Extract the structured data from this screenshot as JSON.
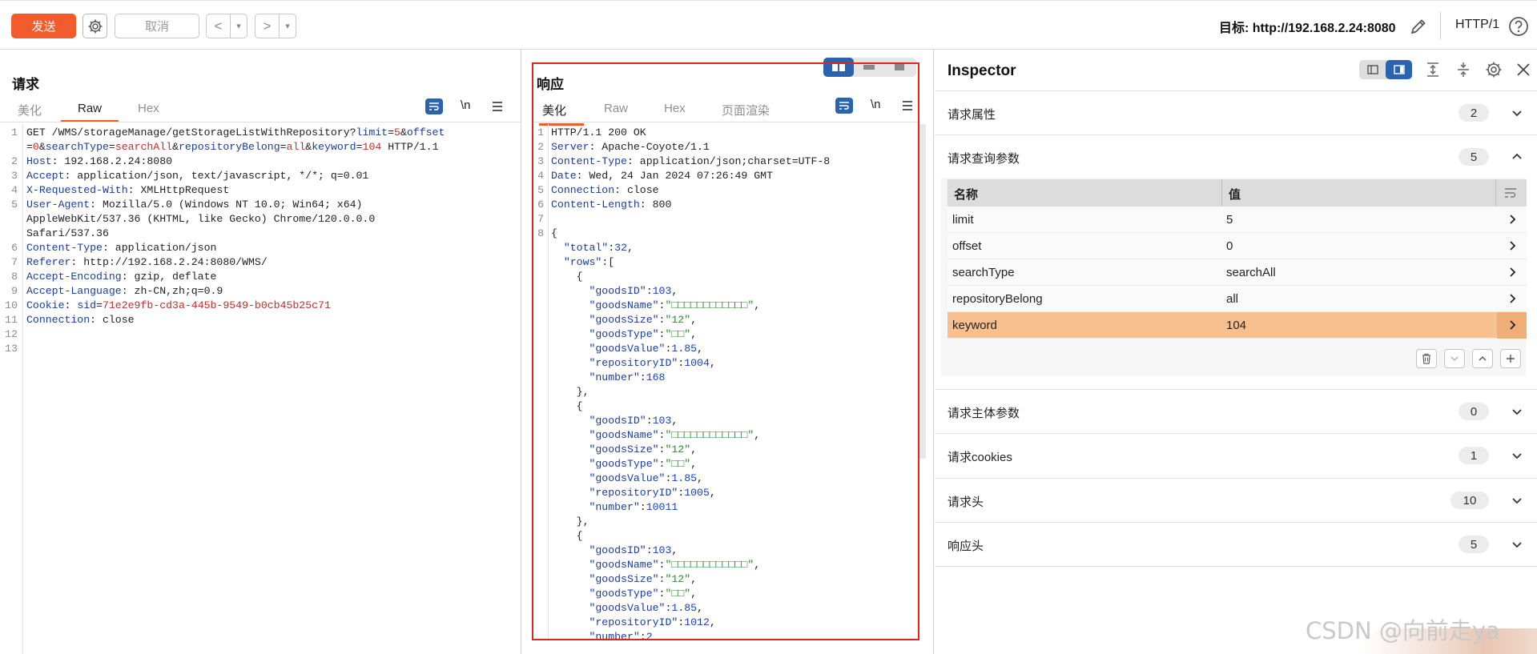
{
  "toolbar": {
    "send_label": "发送",
    "cancel_label": "取消",
    "back_icon": "<",
    "forward_icon": ">",
    "dropdown_icon": "▾",
    "target_label": "目标: http://192.168.2.24:8080",
    "http_version": "HTTP/1"
  },
  "request": {
    "title": "请求",
    "tabs": [
      "美化",
      "Raw",
      "Hex"
    ],
    "active_tab": "Raw",
    "newline_label": "\\n",
    "line_numbers": [
      "1",
      "",
      "2",
      "3",
      "4",
      "5",
      "",
      "",
      "6",
      "7",
      "8",
      "9",
      "10",
      "11",
      "12",
      "13"
    ],
    "lines": [
      [
        [
          "plain",
          "GET /WMS/storageManage/getStorageListWithRepository?"
        ],
        [
          "p",
          "limit"
        ],
        [
          "plain",
          "="
        ],
        [
          "v",
          "5"
        ],
        [
          "plain",
          "&"
        ],
        [
          "p",
          "offset"
        ]
      ],
      [
        [
          "plain",
          "="
        ],
        [
          "v",
          "0"
        ],
        [
          "plain",
          "&"
        ],
        [
          "p",
          "searchType"
        ],
        [
          "plain",
          "="
        ],
        [
          "v",
          "searchAll"
        ],
        [
          "plain",
          "&"
        ],
        [
          "p",
          "repositoryBelong"
        ],
        [
          "plain",
          "="
        ],
        [
          "v",
          "all"
        ],
        [
          "plain",
          "&"
        ],
        [
          "p",
          "keyword"
        ],
        [
          "plain",
          "="
        ],
        [
          "v",
          "104"
        ],
        [
          "plain",
          " HTTP/1.1"
        ]
      ],
      [
        [
          "k",
          "Host"
        ],
        [
          "plain",
          ": 192.168.2.24:8080"
        ]
      ],
      [
        [
          "k",
          "Accept"
        ],
        [
          "plain",
          ": application/json, text/javascript, */*; q=0.01"
        ]
      ],
      [
        [
          "k",
          "X-Requested-With"
        ],
        [
          "plain",
          ": XMLHttpRequest"
        ]
      ],
      [
        [
          "k",
          "User-Agent"
        ],
        [
          "plain",
          ": Mozilla/5.0 (Windows NT 10.0; Win64; x64)"
        ]
      ],
      [
        [
          "plain",
          "AppleWebKit/537.36 (KHTML, like Gecko) Chrome/120.0.0.0"
        ]
      ],
      [
        [
          "plain",
          "Safari/537.36"
        ]
      ],
      [
        [
          "k",
          "Content-Type"
        ],
        [
          "plain",
          ": application/json"
        ]
      ],
      [
        [
          "k",
          "Referer"
        ],
        [
          "plain",
          ": http://192.168.2.24:8080/WMS/"
        ]
      ],
      [
        [
          "k",
          "Accept-Encoding"
        ],
        [
          "plain",
          ": gzip, deflate"
        ]
      ],
      [
        [
          "k",
          "Accept-Language"
        ],
        [
          "plain",
          ": zh-CN,zh;q=0.9"
        ]
      ],
      [
        [
          "k",
          "Cookie"
        ],
        [
          "plain",
          ": "
        ],
        [
          "p",
          "sid"
        ],
        [
          "plain",
          "="
        ],
        [
          "v",
          "71e2e9fb-cd3a-445b-9549-b0cb45b25c71"
        ]
      ],
      [
        [
          "k",
          "Connection"
        ],
        [
          "plain",
          ": close"
        ]
      ],
      [
        [
          "plain",
          ""
        ]
      ],
      [
        [
          "plain",
          ""
        ]
      ]
    ]
  },
  "response": {
    "title": "响应",
    "tabs": [
      "美化",
      "Raw",
      "Hex",
      "页面渲染"
    ],
    "active_tab": "美化",
    "newline_label": "\\n",
    "line_numbers": [
      "1",
      "2",
      "3",
      "4",
      "5",
      "6",
      "7",
      "8"
    ],
    "lines": [
      [
        [
          "plain",
          "HTTP/1.1 200 OK"
        ]
      ],
      [
        [
          "k",
          "Server"
        ],
        [
          "plain",
          ": Apache-Coyote/1.1"
        ]
      ],
      [
        [
          "k",
          "Content-Type"
        ],
        [
          "plain",
          ": application/json;charset=UTF-8"
        ]
      ],
      [
        [
          "k",
          "Date"
        ],
        [
          "plain",
          ": Wed, 24 Jan 2024 07:26:49 GMT"
        ]
      ],
      [
        [
          "k",
          "Connection"
        ],
        [
          "plain",
          ": close"
        ]
      ],
      [
        [
          "k",
          "Content-Length"
        ],
        [
          "plain",
          ": 800"
        ]
      ],
      [
        [
          "plain",
          ""
        ]
      ],
      [
        [
          "plain",
          "{"
        ]
      ],
      [
        [
          "plain",
          "  "
        ],
        [
          "jk",
          "\"total\""
        ],
        [
          "plain",
          ":"
        ],
        [
          "n",
          "32"
        ],
        [
          "plain",
          ","
        ]
      ],
      [
        [
          "plain",
          "  "
        ],
        [
          "jk",
          "\"rows\""
        ],
        [
          "plain",
          ":["
        ]
      ],
      [
        [
          "plain",
          "    {"
        ]
      ],
      [
        [
          "plain",
          "      "
        ],
        [
          "jk",
          "\"goodsID\""
        ],
        [
          "plain",
          ":"
        ],
        [
          "n",
          "103"
        ],
        [
          "plain",
          ","
        ]
      ],
      [
        [
          "plain",
          "      "
        ],
        [
          "jk",
          "\"goodsName\""
        ],
        [
          "plain",
          ":"
        ],
        [
          "s",
          "\"□□□□□□□□□□□□\""
        ],
        [
          "plain",
          ","
        ]
      ],
      [
        [
          "plain",
          "      "
        ],
        [
          "jk",
          "\"goodsSize\""
        ],
        [
          "plain",
          ":"
        ],
        [
          "s",
          "\"12\""
        ],
        [
          "plain",
          ","
        ]
      ],
      [
        [
          "plain",
          "      "
        ],
        [
          "jk",
          "\"goodsType\""
        ],
        [
          "plain",
          ":"
        ],
        [
          "s",
          "\"□□\""
        ],
        [
          "plain",
          ","
        ]
      ],
      [
        [
          "plain",
          "      "
        ],
        [
          "jk",
          "\"goodsValue\""
        ],
        [
          "plain",
          ":"
        ],
        [
          "n",
          "1.85"
        ],
        [
          "plain",
          ","
        ]
      ],
      [
        [
          "plain",
          "      "
        ],
        [
          "jk",
          "\"repositoryID\""
        ],
        [
          "plain",
          ":"
        ],
        [
          "n",
          "1004"
        ],
        [
          "plain",
          ","
        ]
      ],
      [
        [
          "plain",
          "      "
        ],
        [
          "jk",
          "\"number\""
        ],
        [
          "plain",
          ":"
        ],
        [
          "n",
          "168"
        ]
      ],
      [
        [
          "plain",
          "    },"
        ]
      ],
      [
        [
          "plain",
          "    {"
        ]
      ],
      [
        [
          "plain",
          "      "
        ],
        [
          "jk",
          "\"goodsID\""
        ],
        [
          "plain",
          ":"
        ],
        [
          "n",
          "103"
        ],
        [
          "plain",
          ","
        ]
      ],
      [
        [
          "plain",
          "      "
        ],
        [
          "jk",
          "\"goodsName\""
        ],
        [
          "plain",
          ":"
        ],
        [
          "s",
          "\"□□□□□□□□□□□□\""
        ],
        [
          "plain",
          ","
        ]
      ],
      [
        [
          "plain",
          "      "
        ],
        [
          "jk",
          "\"goodsSize\""
        ],
        [
          "plain",
          ":"
        ],
        [
          "s",
          "\"12\""
        ],
        [
          "plain",
          ","
        ]
      ],
      [
        [
          "plain",
          "      "
        ],
        [
          "jk",
          "\"goodsType\""
        ],
        [
          "plain",
          ":"
        ],
        [
          "s",
          "\"□□\""
        ],
        [
          "plain",
          ","
        ]
      ],
      [
        [
          "plain",
          "      "
        ],
        [
          "jk",
          "\"goodsValue\""
        ],
        [
          "plain",
          ":"
        ],
        [
          "n",
          "1.85"
        ],
        [
          "plain",
          ","
        ]
      ],
      [
        [
          "plain",
          "      "
        ],
        [
          "jk",
          "\"repositoryID\""
        ],
        [
          "plain",
          ":"
        ],
        [
          "n",
          "1005"
        ],
        [
          "plain",
          ","
        ]
      ],
      [
        [
          "plain",
          "      "
        ],
        [
          "jk",
          "\"number\""
        ],
        [
          "plain",
          ":"
        ],
        [
          "n",
          "10011"
        ]
      ],
      [
        [
          "plain",
          "    },"
        ]
      ],
      [
        [
          "plain",
          "    {"
        ]
      ],
      [
        [
          "plain",
          "      "
        ],
        [
          "jk",
          "\"goodsID\""
        ],
        [
          "plain",
          ":"
        ],
        [
          "n",
          "103"
        ],
        [
          "plain",
          ","
        ]
      ],
      [
        [
          "plain",
          "      "
        ],
        [
          "jk",
          "\"goodsName\""
        ],
        [
          "plain",
          ":"
        ],
        [
          "s",
          "\"□□□□□□□□□□□□\""
        ],
        [
          "plain",
          ","
        ]
      ],
      [
        [
          "plain",
          "      "
        ],
        [
          "jk",
          "\"goodsSize\""
        ],
        [
          "plain",
          ":"
        ],
        [
          "s",
          "\"12\""
        ],
        [
          "plain",
          ","
        ]
      ],
      [
        [
          "plain",
          "      "
        ],
        [
          "jk",
          "\"goodsType\""
        ],
        [
          "plain",
          ":"
        ],
        [
          "s",
          "\"□□\""
        ],
        [
          "plain",
          ","
        ]
      ],
      [
        [
          "plain",
          "      "
        ],
        [
          "jk",
          "\"goodsValue\""
        ],
        [
          "plain",
          ":"
        ],
        [
          "n",
          "1.85"
        ],
        [
          "plain",
          ","
        ]
      ],
      [
        [
          "plain",
          "      "
        ],
        [
          "jk",
          "\"repositoryID\""
        ],
        [
          "plain",
          ":"
        ],
        [
          "n",
          "1012"
        ],
        [
          "plain",
          ","
        ]
      ],
      [
        [
          "plain",
          "      "
        ],
        [
          "jk",
          "\"number\""
        ],
        [
          "plain",
          ":"
        ],
        [
          "n",
          "2"
        ]
      ]
    ]
  },
  "inspector": {
    "title": "Inspector",
    "sections": [
      {
        "label": "请求属性",
        "count": "2"
      },
      {
        "label": "请求查询参数",
        "count": "5"
      },
      {
        "label": "请求主体参数",
        "count": "0"
      },
      {
        "label": "请求cookies",
        "count": "1"
      },
      {
        "label": "请求头",
        "count": "10"
      },
      {
        "label": "响应头",
        "count": "5"
      }
    ],
    "query_table": {
      "headers": {
        "name": "名称",
        "value": "值"
      },
      "rows": [
        {
          "name": "limit",
          "value": "5"
        },
        {
          "name": "offset",
          "value": "0"
        },
        {
          "name": "searchType",
          "value": "searchAll"
        },
        {
          "name": "repositoryBelong",
          "value": "all"
        },
        {
          "name": "keyword",
          "value": "104"
        }
      ],
      "selected_row": "keyword"
    }
  },
  "watermark": "CSDN @向前走ya",
  "colors": {
    "accent": "#f25c2c",
    "selected_row": "#f8c08f",
    "highlight_box": "#e0251b",
    "toggle_on": "#2a63b0"
  }
}
